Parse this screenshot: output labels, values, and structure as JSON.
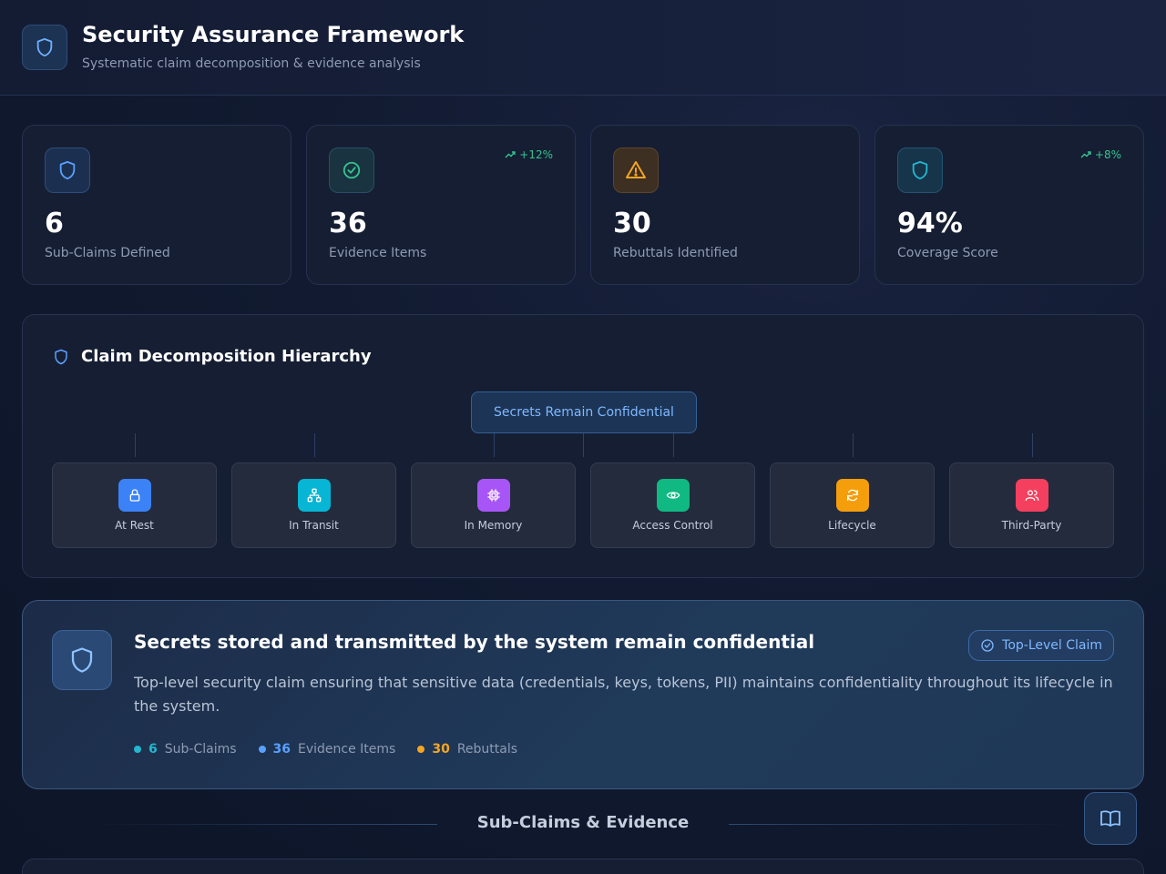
{
  "header": {
    "title": "Security Assurance Framework",
    "subtitle": "Systematic claim decomposition & evidence analysis",
    "logo_icon": "shield-icon"
  },
  "stats": [
    {
      "value": "6",
      "label": "Sub-Claims Defined",
      "icon": "shield-icon",
      "trend": "",
      "color": "#5aa0ff"
    },
    {
      "value": "36",
      "label": "Evidence Items",
      "icon": "check-circle-icon",
      "trend": "+12%",
      "color": "#34c38f"
    },
    {
      "value": "30",
      "label": "Rebuttals Identified",
      "icon": "warning-icon",
      "trend": "",
      "color": "#f5a524"
    },
    {
      "value": "94%",
      "label": "Coverage Score",
      "icon": "shield-icon",
      "trend": "+8%",
      "color": "#22b8cf"
    }
  ],
  "hierarchy": {
    "title": "Claim Decomposition Hierarchy",
    "root": "Secrets Remain Confidential",
    "children": [
      {
        "label": "At Rest",
        "icon": "lock-icon",
        "color": "#3b82f6"
      },
      {
        "label": "In Transit",
        "icon": "network-icon",
        "color": "#06b6d4"
      },
      {
        "label": "In Memory",
        "icon": "cpu-icon",
        "color": "#a855f7"
      },
      {
        "label": "Access Control",
        "icon": "eye-icon",
        "color": "#10b981"
      },
      {
        "label": "Lifecycle",
        "icon": "refresh-icon",
        "color": "#f59e0b"
      },
      {
        "label": "Third-Party",
        "icon": "users-icon",
        "color": "#f43f5e"
      }
    ]
  },
  "claim": {
    "title": "Secrets stored and transmitted by the system remain confidential",
    "badge": "Top-Level Claim",
    "description": "Top-level security claim ensuring that sensitive data (credentials, keys, tokens, PII) maintains confidentiality throughout its lifecycle in the system.",
    "stats": [
      {
        "count": "6",
        "label": "Sub-Claims",
        "color": "#22b8cf"
      },
      {
        "count": "36",
        "label": "Evidence Items",
        "color": "#5aa0ff"
      },
      {
        "count": "30",
        "label": "Rebuttals",
        "color": "#f5a524"
      }
    ]
  },
  "section": {
    "title": "Sub-Claims & Evidence"
  },
  "fab": {
    "icon": "book-icon"
  }
}
